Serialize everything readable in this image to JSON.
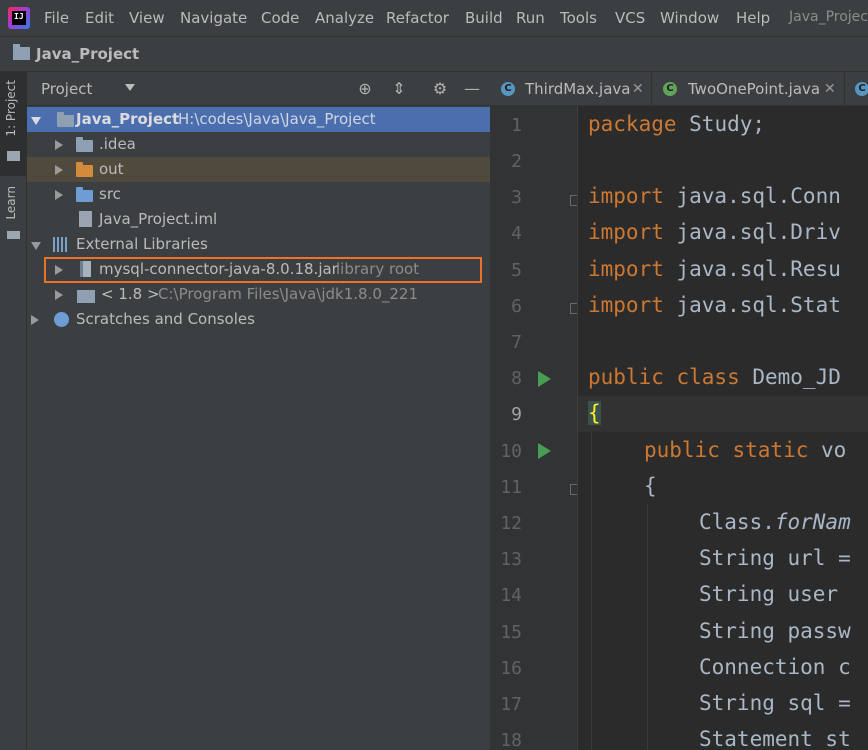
{
  "menu": {
    "items": [
      "File",
      "Edit",
      "View",
      "Navigate",
      "Code",
      "Analyze",
      "Refactor",
      "Build",
      "Run",
      "Tools",
      "VCS",
      "Window",
      "Help"
    ],
    "window_title": "Java_Projec"
  },
  "navbar": {
    "project": "Java_Project"
  },
  "tool_strip": {
    "project_tab": "1: Project",
    "learn_tab": "Learn"
  },
  "project_panel": {
    "title": "Project",
    "tree": {
      "root_name": "Java_Project",
      "root_path": "H:\\codes\\Java\\Java_Project",
      "idea": ".idea",
      "out": "out",
      "src": "src",
      "iml": "Java_Project.iml",
      "ext_libs": "External Libraries",
      "jar_name": "mysql-connector-java-8.0.18.jar",
      "jar_note": "library root",
      "jdk_name": "< 1.8 >",
      "jdk_path": "C:\\Program Files\\Java\\jdk1.8.0_221",
      "scratches": "Scratches and Consoles"
    }
  },
  "editor": {
    "tabs": [
      "ThirdMax.java",
      "TwoOnePoint.java"
    ],
    "line_numbers": [
      "1",
      "2",
      "3",
      "4",
      "5",
      "6",
      "7",
      "8",
      "9",
      "10",
      "11",
      "12",
      "13",
      "14",
      "15",
      "16",
      "17",
      "18"
    ],
    "code": {
      "l1_kw": "package",
      "l1_rest": " Study;",
      "l3_kw": "import",
      "l3_rest": " java.sql.Conn",
      "l4_kw": "import",
      "l4_rest": " java.sql.Driv",
      "l5_kw": "import",
      "l5_rest": " java.sql.Resu",
      "l6_kw": "import",
      "l6_rest": " java.sql.Stat",
      "l8_kw": "public class",
      "l8_rest": " Demo_JD",
      "l9": "{",
      "l10_kw": "public static",
      "l10_rest": " vo",
      "l11": "{",
      "l12_a": "Class.",
      "l12_b": "forNam",
      "l13": "String url =",
      "l14": "String user",
      "l15": "String passw",
      "l16": "Connection c",
      "l17": "String sql =",
      "l18": "Statement st"
    }
  },
  "colors": {
    "accent_selection": "#4b6eaf",
    "highlight_box": "#e8742a",
    "keyword": "#cc7832",
    "run_marker": "#499c54"
  }
}
